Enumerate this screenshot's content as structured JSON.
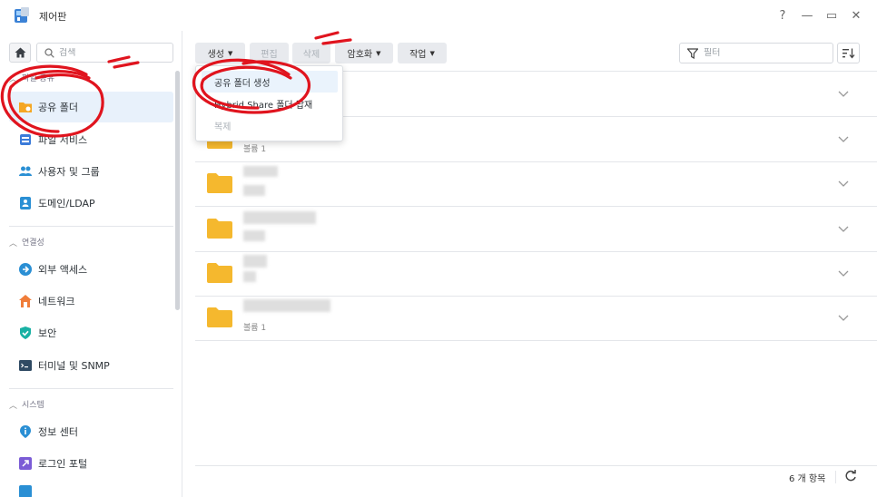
{
  "window": {
    "title": "제어판",
    "controls": {
      "help": "?",
      "minimize": "—",
      "maximize": "▭",
      "close": "✕"
    }
  },
  "sidebar": {
    "search_placeholder": "검색",
    "sections": [
      {
        "label": "파일 공유"
      },
      {
        "label": "연결성"
      },
      {
        "label": "시스템"
      }
    ],
    "items": [
      {
        "label": "공유 폴더",
        "icon": "shared-folder-icon",
        "active": true
      },
      {
        "label": "파일 서비스",
        "icon": "file-services-icon"
      },
      {
        "label": "사용자 및 그룹",
        "icon": "users-icon"
      },
      {
        "label": "도메인/LDAP",
        "icon": "domain-icon"
      },
      {
        "label": "외부 액세스",
        "icon": "external-access-icon"
      },
      {
        "label": "네트워크",
        "icon": "network-icon"
      },
      {
        "label": "보안",
        "icon": "shield-icon"
      },
      {
        "label": "터미널 및 SNMP",
        "icon": "terminal-icon"
      },
      {
        "label": "정보 센터",
        "icon": "info-icon"
      },
      {
        "label": "로그인 포털",
        "icon": "login-portal-icon"
      }
    ]
  },
  "toolbar": {
    "create": "생성",
    "edit": "편집",
    "delete": "삭제",
    "encrypt": "암호화",
    "action": "작업",
    "filter_placeholder": "필터"
  },
  "menu": {
    "items": [
      {
        "label": "공유 폴더 생성"
      },
      {
        "label": "Hybrid Share 폴더 탑재"
      },
      {
        "label": "복제",
        "disabled": true
      }
    ]
  },
  "rows": [
    {
      "volume": ""
    },
    {
      "volume": "볼륨 1"
    },
    {
      "volume": ""
    },
    {
      "volume": ""
    },
    {
      "volume": ""
    },
    {
      "volume": "볼륨 1"
    }
  ],
  "footer": {
    "count": "6 개 항목"
  },
  "colors": {
    "accent": "#1f8bd6",
    "folder": "#f5b82e",
    "annotation": "#e0141e"
  }
}
